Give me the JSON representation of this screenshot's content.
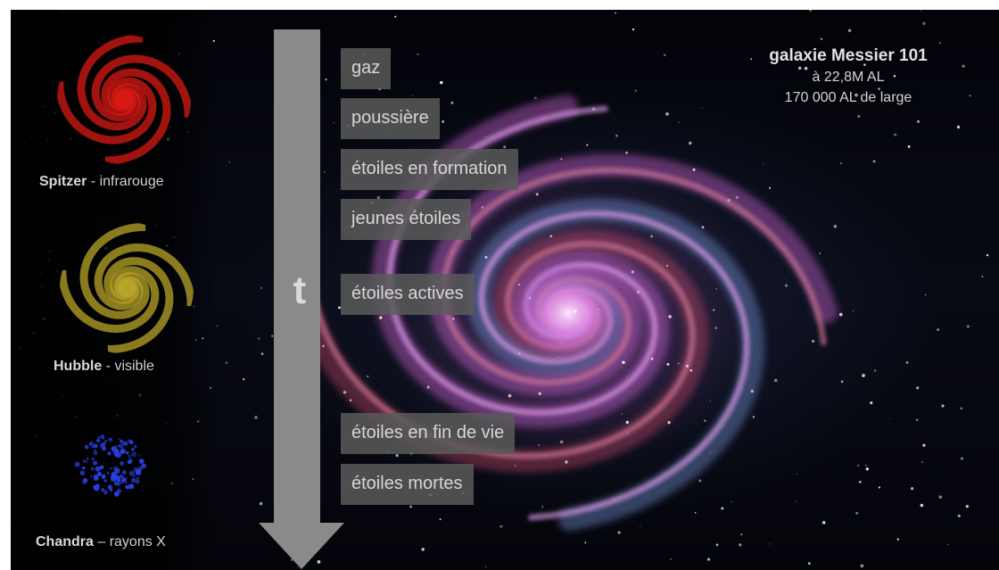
{
  "galaxy": {
    "title": "galaxie Messier 101",
    "distance": "à 22,8M AL",
    "width": "170 000 AL de large"
  },
  "timeline": {
    "axis_label": "t",
    "stages": [
      {
        "label": "gaz"
      },
      {
        "label": "poussière"
      },
      {
        "label": "étoiles en formation"
      },
      {
        "label": "jeunes étoiles"
      },
      {
        "label": "étoiles actives"
      },
      {
        "label": "étoiles en fin de vie"
      },
      {
        "label": "étoiles mortes"
      }
    ]
  },
  "telescopes": [
    {
      "name": "Spitzer",
      "separator": " - ",
      "band": "infrarouge",
      "color": "#d81a14"
    },
    {
      "name": "Hubble",
      "separator": " - ",
      "band": "visible",
      "color": "#b8a428"
    },
    {
      "name": "Chandra",
      "separator": " – ",
      "band": "rayons X",
      "color": "#2a3fe0"
    }
  ],
  "colors": {
    "galaxy_core": "#f4c8f8",
    "arm_magenta": "#c060c8",
    "arm_blue": "#6c88c8",
    "arm_red": "#b04060",
    "label_background": "#5a5a5a",
    "arrow": "#8a8a8a",
    "text": "#d6d6d6"
  }
}
